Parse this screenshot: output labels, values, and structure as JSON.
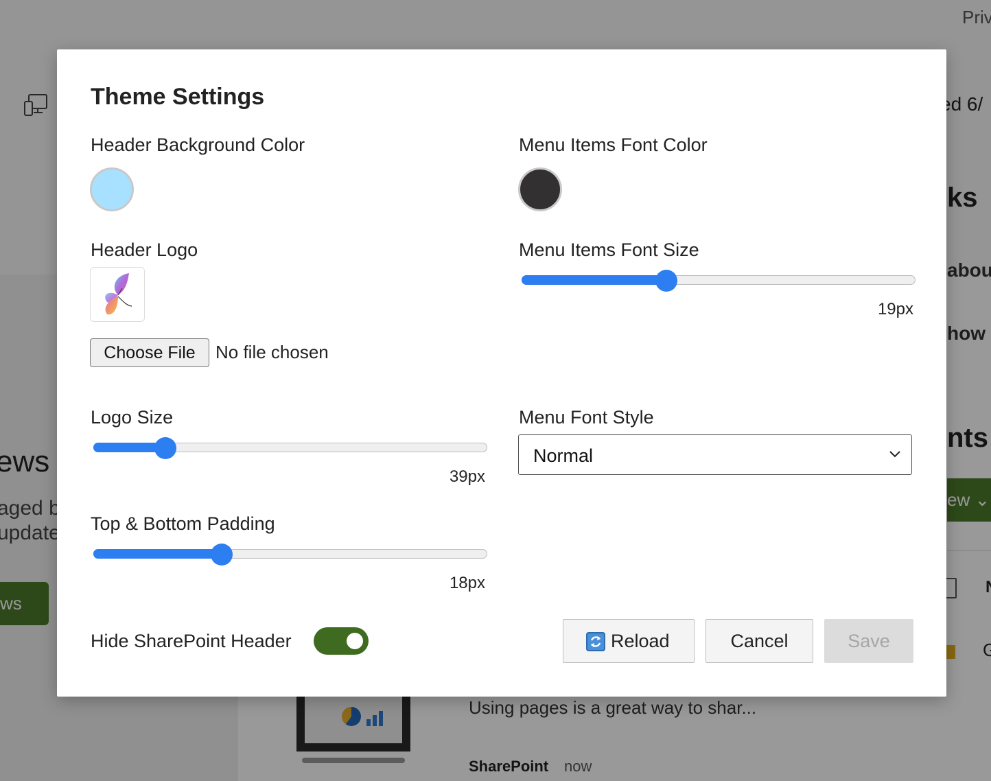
{
  "background": {
    "top_right_link": "Priv",
    "date_fragment": "ed 6/",
    "quick_links_heading_fragment": "ks",
    "link_item_1_fragment": "abou",
    "link_item_2_fragment": "how t",
    "events_heading_fragment": "nts",
    "view_button_fragment": "ew",
    "news_title_fragment": "ews",
    "news_text_line1_fragment": "aged b",
    "news_text_line2_fragment": "update",
    "news_button_fragment": "ws",
    "doc_row_fragment": "N",
    "file_row_fragment": "G",
    "page_card_text": "Using pages is a great way to shar...",
    "page_card_author": "SharePoint",
    "page_card_time": "now"
  },
  "dialog": {
    "title": "Theme Settings",
    "header_bg_color": {
      "label": "Header Background Color",
      "value": "#a8e0ff"
    },
    "menu_font_color": {
      "label": "Menu Items Font Color",
      "value": "#333031"
    },
    "header_logo": {
      "label": "Header Logo",
      "choose_file_label": "Choose File",
      "file_status": "No file chosen"
    },
    "menu_font_size": {
      "label": "Menu Items Font Size",
      "value_text": "19px",
      "fraction": 0.36
    },
    "logo_size": {
      "label": "Logo Size",
      "value_text": "39px",
      "fraction": 0.165
    },
    "menu_font_style": {
      "label": "Menu Font Style",
      "selected": "Normal"
    },
    "padding": {
      "label": "Top & Bottom Padding",
      "value_text": "18px",
      "fraction": 0.315
    },
    "hide_header": {
      "label": "Hide SharePoint Header",
      "on": true
    },
    "buttons": {
      "reload": "Reload",
      "cancel": "Cancel",
      "save": "Save"
    }
  },
  "colors": {
    "accent": "#2d7ef0",
    "toggle_on": "#3e6b1f",
    "brand_green": "#4b7a2a"
  }
}
